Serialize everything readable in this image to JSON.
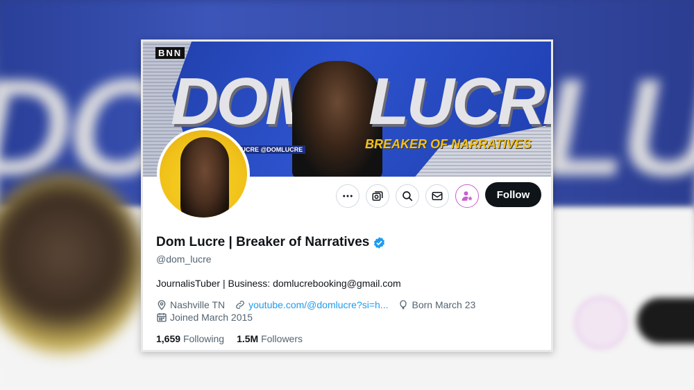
{
  "banner": {
    "logo": "BNN",
    "title_word_1": "DOM",
    "title_word_2": "LUCRE",
    "tagline": "BREAKER OF NARRATIVES",
    "handle_strip": "LUCRE @DOMLUCRE"
  },
  "profile": {
    "display_name": "Dom Lucre | Breaker of Narratives",
    "username": "@dom_lucre",
    "bio": "JournalisTuber | Business: domlucrebooking@gmail.com",
    "location": "Nashville TN",
    "website": "youtube.com/@domlucre?si=h...",
    "birthday": "Born March 23",
    "joined": "Joined March 2015",
    "following_count": "1,659",
    "following_label": "Following",
    "followers_count": "1.5M",
    "followers_label": "Followers",
    "verified": true
  },
  "actions": {
    "follow_label": "Follow"
  },
  "colors": {
    "accent_blue": "#1d9bf0",
    "follow_bg": "#0f1419",
    "secondary_text": "#536471",
    "creator_icon": "#c85fd0"
  },
  "icons": {
    "more": "more-dots-icon",
    "subscribe": "subscription-icon",
    "search": "search-icon",
    "message": "mail-icon",
    "creator": "creator-subscribe-icon",
    "location": "location-pin-icon",
    "link": "link-icon",
    "birthday": "balloon-icon",
    "calendar": "calendar-icon",
    "verified": "verified-badge-icon"
  }
}
